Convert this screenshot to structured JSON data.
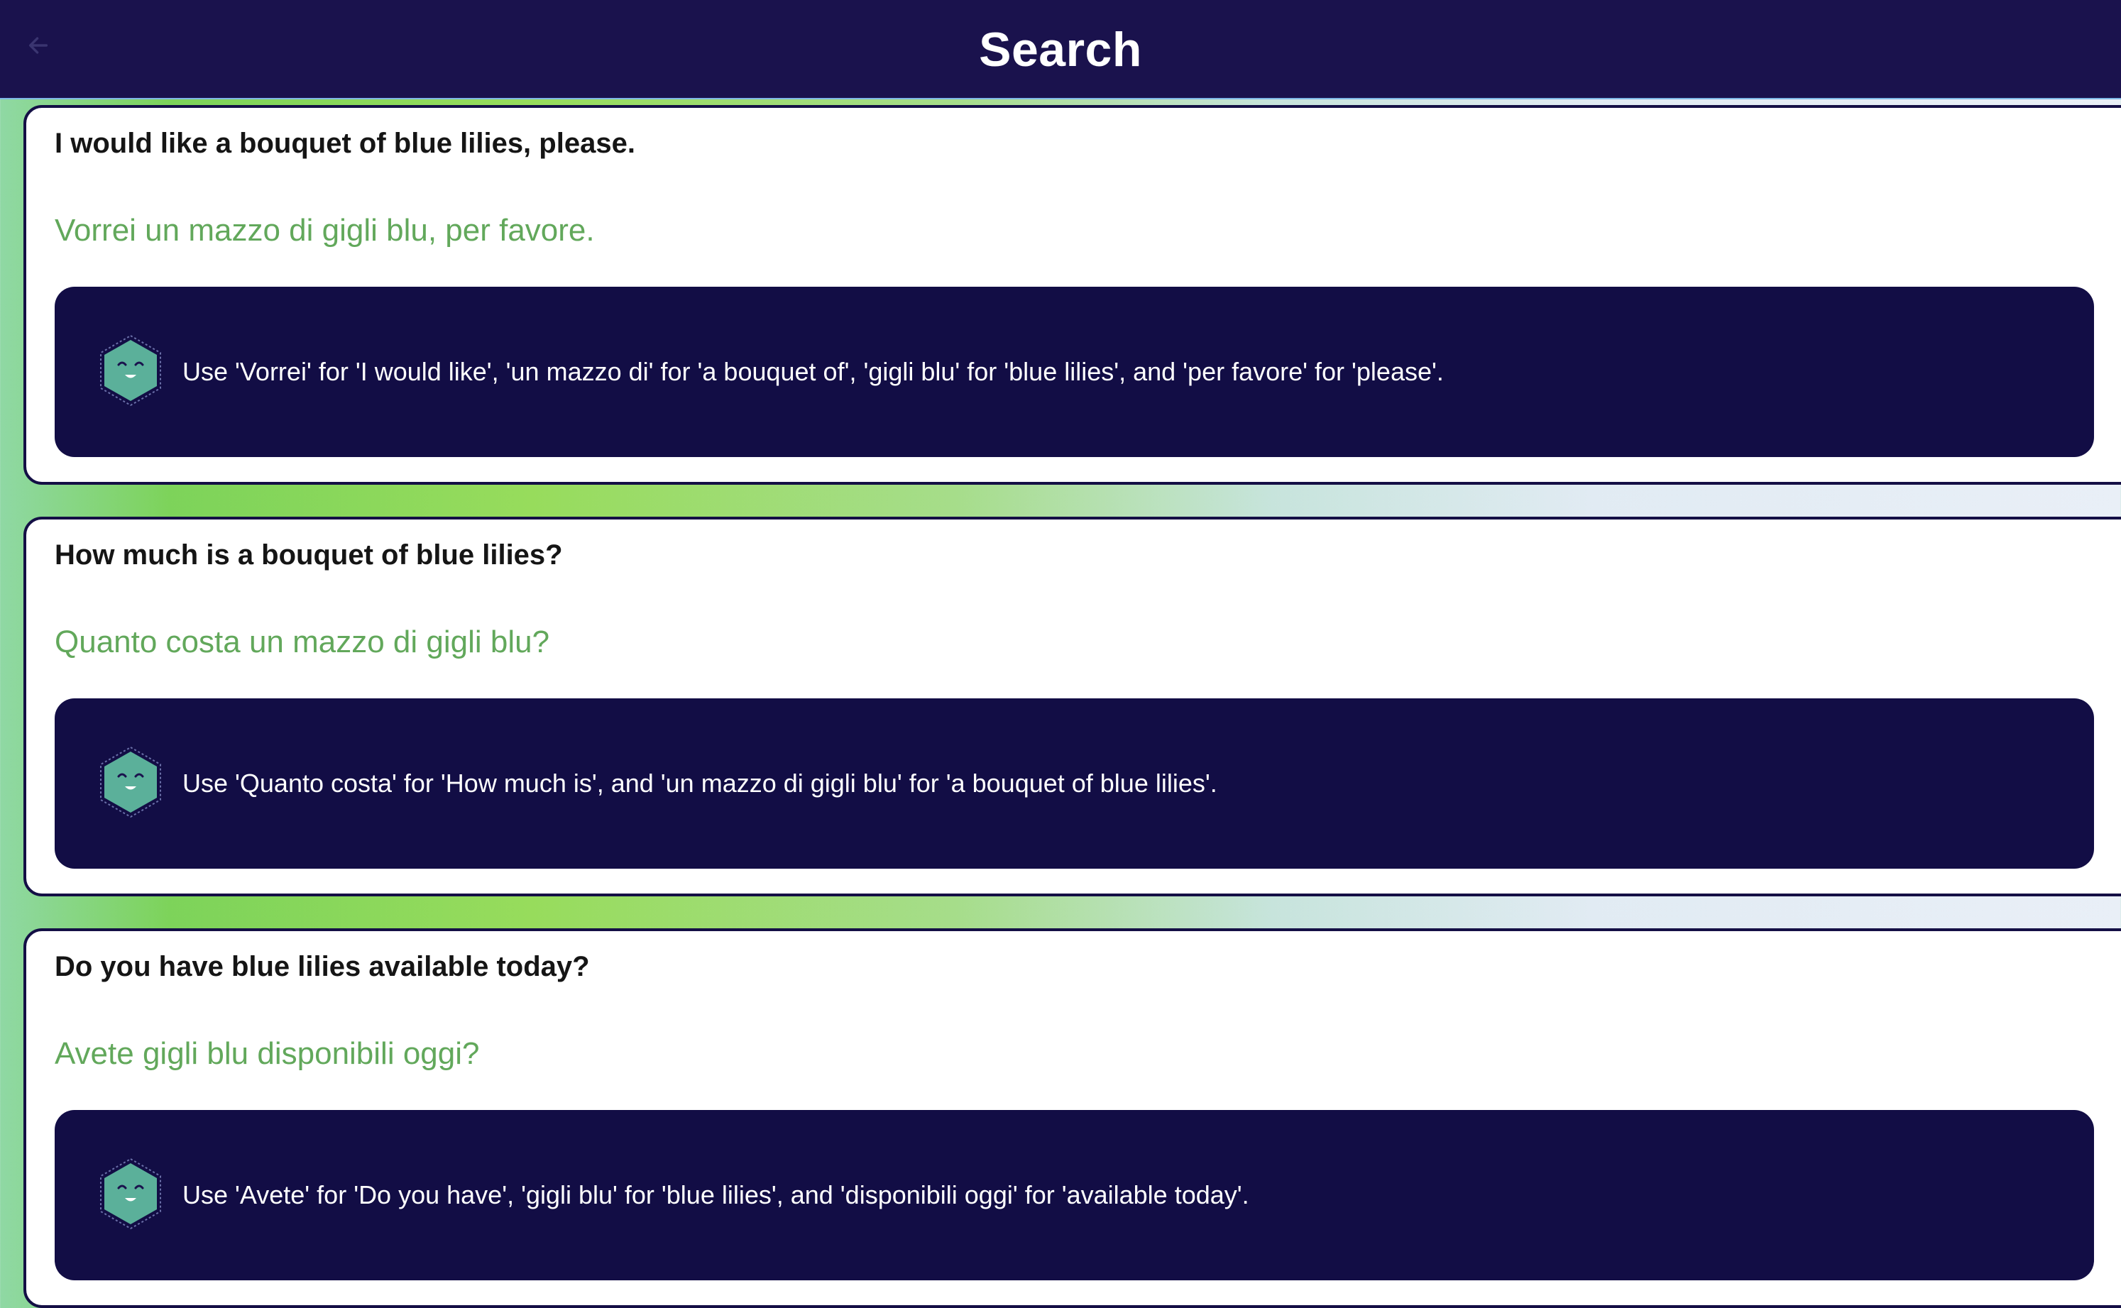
{
  "header": {
    "title": "Search",
    "back_icon": "arrow-left-icon"
  },
  "colors": {
    "header_bg": "#1a124d",
    "card_border": "#140f45",
    "tip_bg": "#120d45",
    "italian_text": "#62a85b",
    "mascot": "#5bb09a"
  },
  "results": [
    {
      "english": "I would like a bouquet of blue lilies, please.",
      "italian": "Vorrei un mazzo di gigli blu, per favore.",
      "tip": "Use 'Vorrei' for 'I would like', 'un mazzo di' for 'a bouquet of', 'gigli blu' for 'blue lilies', and 'per favore' for 'please'.",
      "icon": "smiling-hexagon-mascot-icon"
    },
    {
      "english": "How much is a bouquet of blue lilies?",
      "italian": "Quanto costa un mazzo di gigli blu?",
      "tip": "Use 'Quanto costa' for 'How much is', and 'un mazzo di gigli blu' for 'a bouquet of blue lilies'.",
      "icon": "smiling-hexagon-mascot-icon"
    },
    {
      "english": "Do you have blue lilies available today?",
      "italian": "Avete gigli blu disponibili oggi?",
      "tip": "Use 'Avete' for 'Do you have', 'gigli blu' for 'blue lilies', and 'disponibili oggi' for 'available today'.",
      "icon": "smiling-hexagon-mascot-icon"
    }
  ]
}
